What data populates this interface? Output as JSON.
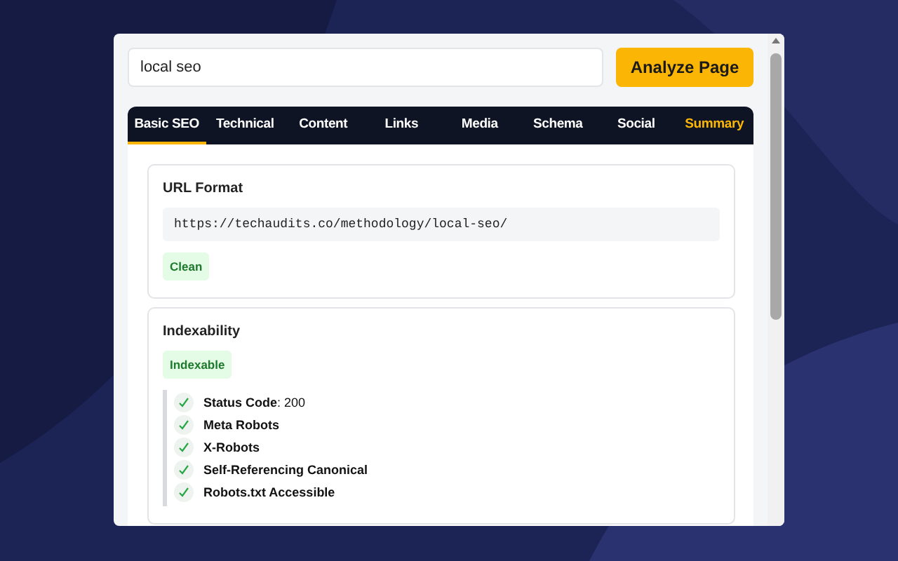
{
  "search": {
    "value": "local seo"
  },
  "analyze_button": "Analyze Page",
  "tabs": [
    {
      "label": "Basic SEO",
      "selected": true,
      "highlighted": false
    },
    {
      "label": "Technical",
      "selected": false,
      "highlighted": false
    },
    {
      "label": "Content",
      "selected": false,
      "highlighted": false
    },
    {
      "label": "Links",
      "selected": false,
      "highlighted": false
    },
    {
      "label": "Media",
      "selected": false,
      "highlighted": false
    },
    {
      "label": "Schema",
      "selected": false,
      "highlighted": false
    },
    {
      "label": "Social",
      "selected": false,
      "highlighted": false
    },
    {
      "label": "Summary",
      "selected": false,
      "highlighted": true
    }
  ],
  "sections": [
    {
      "title": "URL Format",
      "url": "https://techaudits.co/methodology/local-seo/",
      "badge": "Clean"
    },
    {
      "title": "Indexability",
      "badge": "Indexable",
      "checks": [
        {
          "text": "**Status Code**: 200",
          "passed": true
        },
        {
          "text": "Meta Robots",
          "passed": true
        },
        {
          "text": "X-Robots",
          "passed": true
        },
        {
          "text": "Self-Referencing Canonical",
          "passed": true
        },
        {
          "text": "Robots.txt Accessible",
          "passed": true
        }
      ]
    }
  ]
}
